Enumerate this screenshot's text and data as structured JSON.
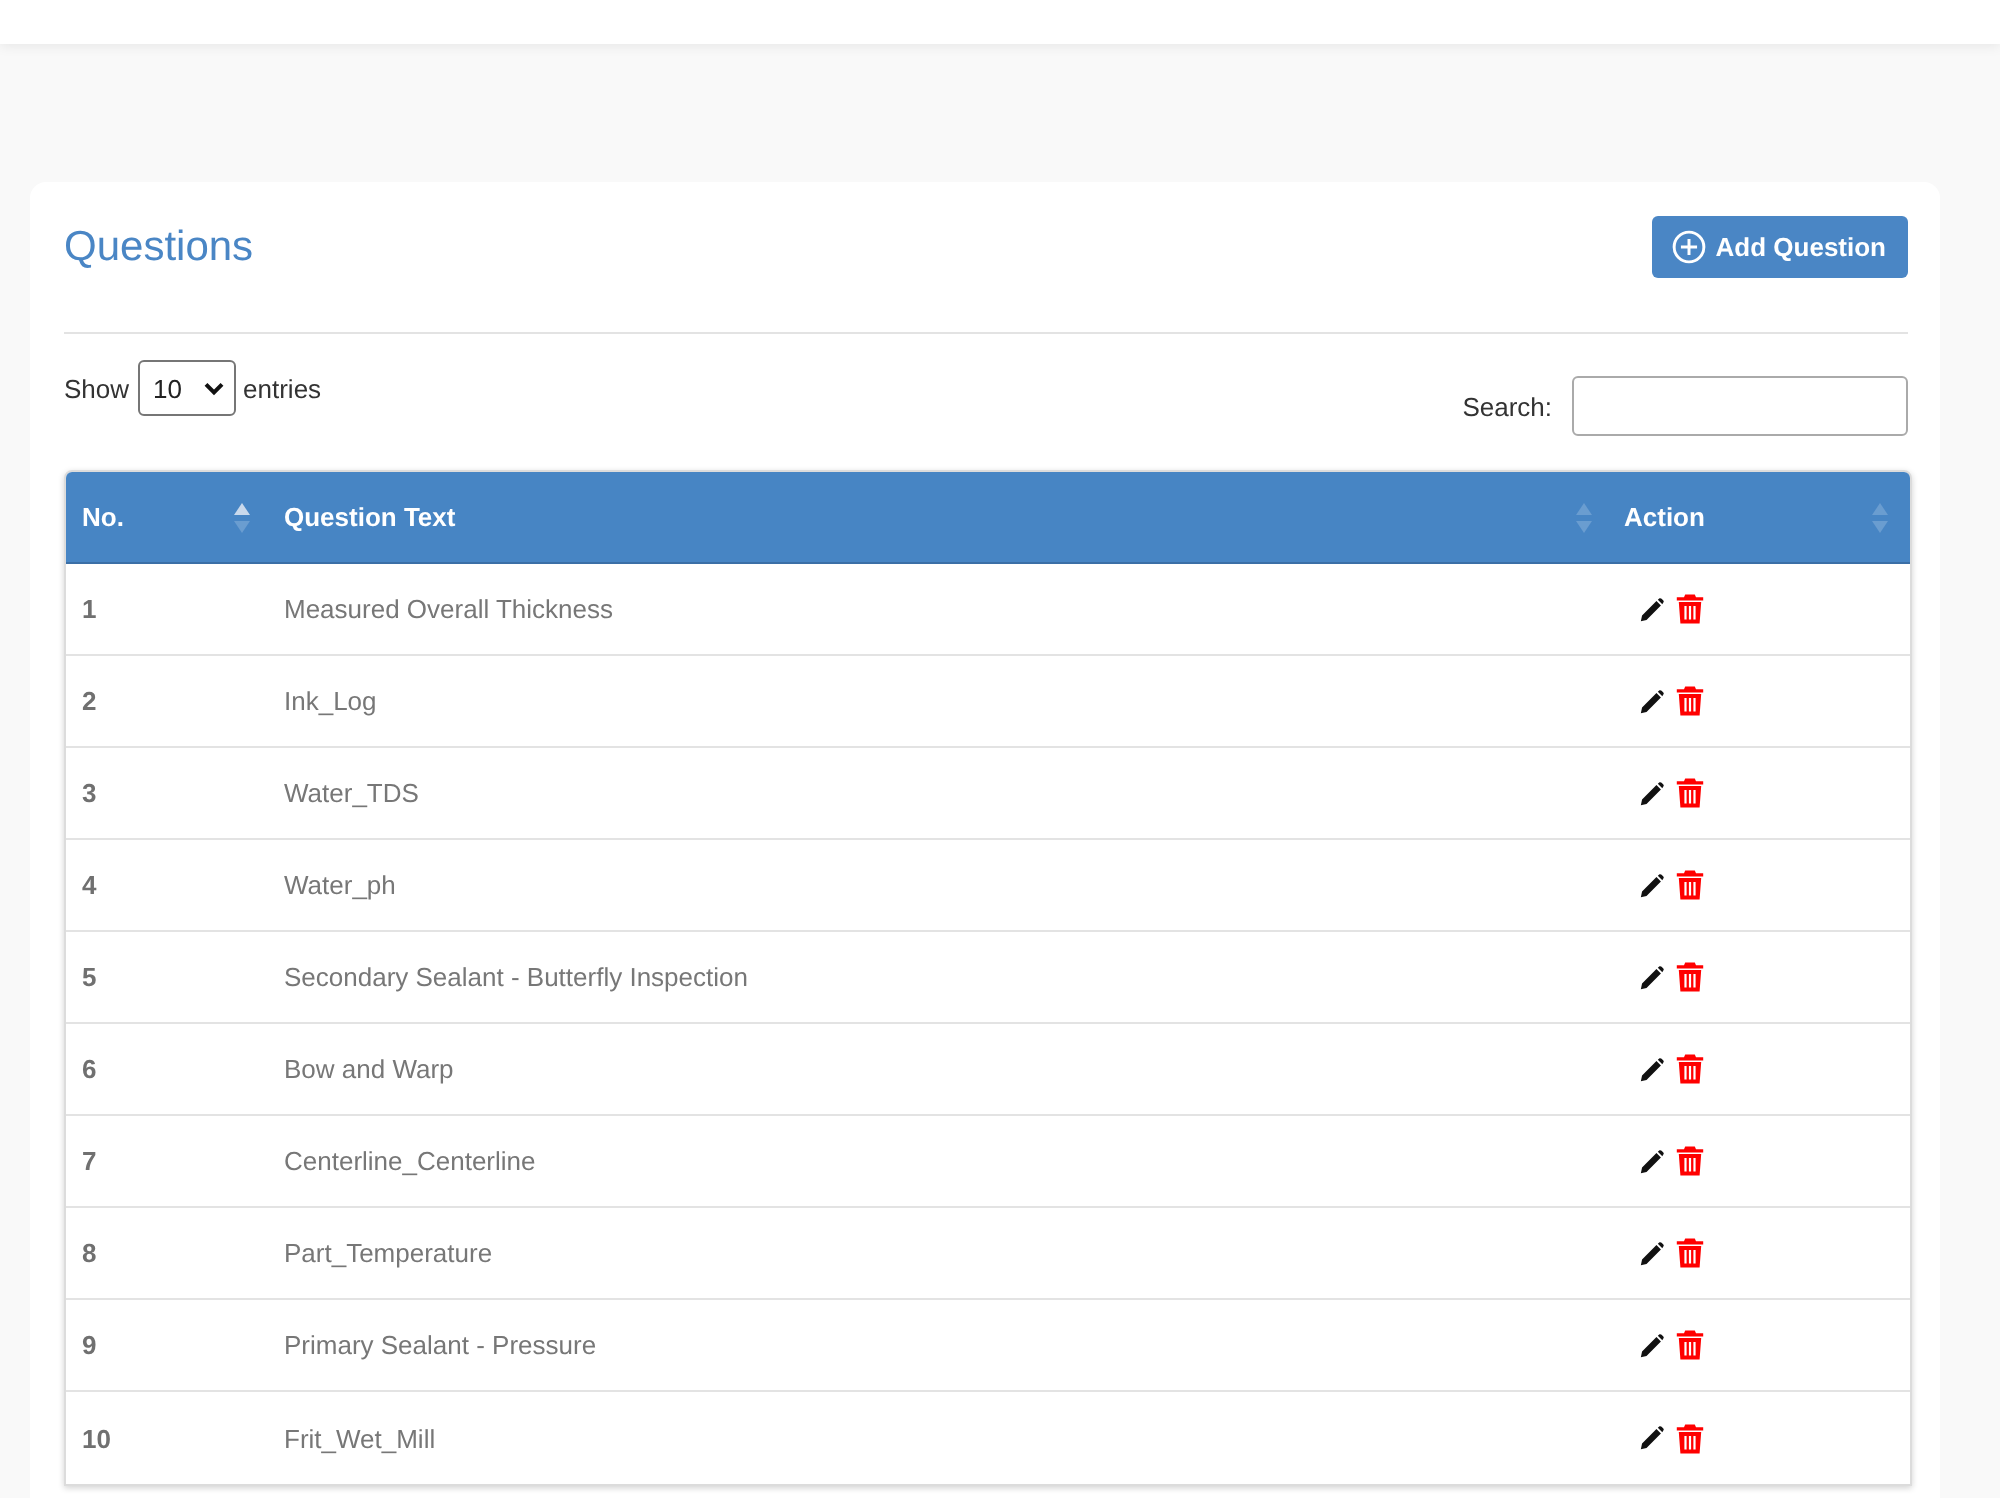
{
  "card": {
    "title": "Questions",
    "add_button": {
      "label": "Add Question"
    }
  },
  "length_control": {
    "prefix": "Show",
    "value": "10",
    "suffix": "entries"
  },
  "search": {
    "label": "Search:"
  },
  "table": {
    "columns": [
      {
        "label": "No.",
        "sorted": true
      },
      {
        "label": "Question Text",
        "sorted": false
      },
      {
        "label": "Action",
        "sorted": false
      }
    ],
    "rows": [
      {
        "number": "1",
        "text": "Measured Overall Thickness"
      },
      {
        "number": "2",
        "text": "Ink_Log"
      },
      {
        "number": "3",
        "text": "Water_TDS"
      },
      {
        "number": "4",
        "text": "Water_ph"
      },
      {
        "number": "5",
        "text": "Secondary Sealant - Butterfly Inspection"
      },
      {
        "number": "6",
        "text": "Bow and Warp"
      },
      {
        "number": "7",
        "text": "Centerline_Centerline"
      },
      {
        "number": "8",
        "text": "Part_Temperature"
      },
      {
        "number": "9",
        "text": "Primary Sealant - Pressure"
      },
      {
        "number": "10",
        "text": "Frit_Wet_Mill"
      }
    ]
  }
}
